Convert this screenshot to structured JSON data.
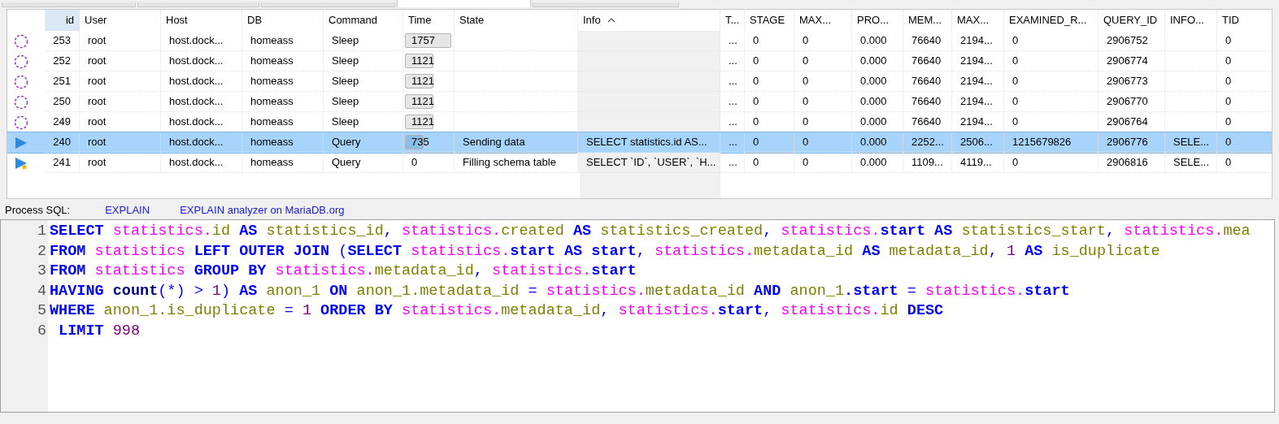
{
  "tabs": [
    {
      "selected": false
    },
    {
      "selected": false
    },
    {
      "selected": false
    },
    {
      "selected": true
    },
    {
      "selected": false
    }
  ],
  "columns": [
    {
      "sorted": false
    },
    {
      "label": "id",
      "sorted": false
    },
    {
      "label": "User",
      "sorted": false
    },
    {
      "label": "Host",
      "sorted": false
    },
    {
      "label": "DB",
      "sorted": false
    },
    {
      "label": "Command",
      "sorted": false
    },
    {
      "label": "Time",
      "sorted": false
    },
    {
      "label": "State",
      "sorted": false
    },
    {
      "label": "Info",
      "sorted": true
    },
    {
      "label": "T...",
      "sorted": false
    },
    {
      "label": "STAGE",
      "sorted": false
    },
    {
      "label": "MAX...",
      "sorted": false
    },
    {
      "label": "PRO...",
      "sorted": false
    },
    {
      "label": "MEM...",
      "sorted": false
    },
    {
      "label": "MAX...",
      "sorted": false
    },
    {
      "label": "EXAMINED_R...",
      "sorted": false
    },
    {
      "label": "QUERY_ID",
      "sorted": false
    },
    {
      "label": "INFO...",
      "sorted": false
    },
    {
      "label": "TID",
      "sorted": false
    }
  ],
  "rows": [
    {
      "kind": "sleep",
      "selected": false,
      "id": "253",
      "user": "root",
      "host": "host.dock...",
      "db": "homeass",
      "command": "Sleep",
      "time": "1757",
      "level": 1,
      "cells": [
        "...",
        "0",
        "0",
        "0.000",
        "76640",
        "2194...",
        "0",
        "2906752",
        null,
        "0"
      ]
    },
    {
      "kind": "sleep",
      "selected": false,
      "id": "252",
      "user": "root",
      "host": "host.dock...",
      "db": "homeass",
      "command": "Sleep",
      "time": "1121",
      "level": 0.62,
      "cells": [
        "...",
        "0",
        "0",
        "0.000",
        "76640",
        "2194...",
        "0",
        "2906774",
        null,
        "0"
      ]
    },
    {
      "kind": "sleep",
      "selected": false,
      "id": "251",
      "user": "root",
      "host": "host.dock...",
      "db": "homeass",
      "command": "Sleep",
      "time": "1121",
      "level": 0.62,
      "cells": [
        "...",
        "0",
        "0",
        "0.000",
        "76640",
        "2194...",
        "0",
        "2906773",
        null,
        "0"
      ]
    },
    {
      "kind": "sleep",
      "selected": false,
      "id": "250",
      "user": "root",
      "host": "host.dock...",
      "db": "homeass",
      "command": "Sleep",
      "time": "1121",
      "level": 0.62,
      "cells": [
        "...",
        "0",
        "0",
        "0.000",
        "76640",
        "2194...",
        "0",
        "2906770",
        null,
        "0"
      ]
    },
    {
      "kind": "sleep",
      "selected": false,
      "id": "249",
      "user": "root",
      "host": "host.dock...",
      "db": "homeass",
      "command": "Sleep",
      "time": "1121",
      "level": 0.62,
      "cells": [
        "...",
        "0",
        "0",
        "0.000",
        "76640",
        "2194...",
        "0",
        "2906764",
        null,
        "0"
      ]
    },
    {
      "kind": "query",
      "selected": true,
      "id": "240",
      "user": "root",
      "host": "host.dock...",
      "db": "homeass",
      "command": "Query",
      "time": "735",
      "level": 0.4,
      "state": "Sending data",
      "info": "SELECT statistics.id AS...",
      "cells": [
        "...",
        "0",
        "0",
        "0.000",
        "2252...",
        "2506...",
        "1215679826",
        "2906776",
        "SELE...",
        "0"
      ]
    },
    {
      "kind": "query_new",
      "selected": false,
      "id": "241",
      "user": "root",
      "host": "host.dock...",
      "db": "homeass",
      "command": "Query",
      "time": "0",
      "state": "Filling schema table",
      "info": "SELECT `ID`, `USER`, `H...",
      "cells": [
        "...",
        "0",
        "0",
        "0.000",
        "1109...",
        "4119...",
        "0",
        "2906816",
        "SELE...",
        "0"
      ]
    }
  ],
  "process_sql": {
    "label": "Process SQL:",
    "links": [
      "EXPLAIN",
      "EXPLAIN analyzer on MariaDB.org"
    ]
  },
  "editor": {
    "lines": [
      {
        "number": "1",
        "tokens": [
          {
            "kind": "kw",
            "text": "SELECT"
          },
          {
            "kind": "tbl",
            "text": " statistics."
          },
          {
            "kind": "col",
            "text": "id"
          },
          {
            "kind": "kw",
            "text": " AS"
          },
          {
            "kind": "col",
            "text": " statistics_id"
          },
          {
            "kind": "op",
            "text": ","
          },
          {
            "kind": "tbl",
            "text": " statistics."
          },
          {
            "kind": "col",
            "text": "created"
          },
          {
            "kind": "kw",
            "text": " AS"
          },
          {
            "kind": "col",
            "text": " statistics_created"
          },
          {
            "kind": "op",
            "text": ","
          },
          {
            "kind": "tbl",
            "text": " statistics."
          },
          {
            "kind": "kw",
            "text": "start"
          },
          {
            "kind": "kw",
            "text": " AS"
          },
          {
            "kind": "col",
            "text": " statistics_start"
          },
          {
            "kind": "op",
            "text": ","
          },
          {
            "kind": "tbl",
            "text": " statistics."
          },
          {
            "kind": "col",
            "text": "mea"
          }
        ]
      },
      {
        "number": "2",
        "tokens": [
          {
            "kind": "kw",
            "text": "FROM"
          },
          {
            "kind": "tbl",
            "text": " statistics"
          },
          {
            "kind": "kw",
            "text": " LEFT OUTER JOIN"
          },
          {
            "kind": "op",
            "text": " ("
          },
          {
            "kind": "kw",
            "text": "SELECT"
          },
          {
            "kind": "tbl",
            "text": " statistics."
          },
          {
            "kind": "kw",
            "text": "start"
          },
          {
            "kind": "kw",
            "text": " AS start"
          },
          {
            "kind": "op",
            "text": ","
          },
          {
            "kind": "tbl",
            "text": " statistics."
          },
          {
            "kind": "col",
            "text": "metadata_id"
          },
          {
            "kind": "kw",
            "text": " AS"
          },
          {
            "kind": "col",
            "text": " metadata_id"
          },
          {
            "kind": "op",
            "text": ","
          },
          {
            "kind": "num",
            "text": " 1"
          },
          {
            "kind": "kw",
            "text": " AS"
          },
          {
            "kind": "col",
            "text": " is_duplicate"
          }
        ]
      },
      {
        "number": "3",
        "tokens": [
          {
            "kind": "kw",
            "text": "FROM"
          },
          {
            "kind": "tbl",
            "text": " statistics"
          },
          {
            "kind": "kw",
            "text": " GROUP BY"
          },
          {
            "kind": "tbl",
            "text": " statistics."
          },
          {
            "kind": "col",
            "text": "metadata_id"
          },
          {
            "kind": "op",
            "text": ","
          },
          {
            "kind": "tbl",
            "text": " statistics."
          },
          {
            "kind": "kw",
            "text": "start"
          }
        ]
      },
      {
        "number": "4",
        "tokens": [
          {
            "kind": "kw",
            "text": "HAVING"
          },
          {
            "kind": "fn",
            "text": " count"
          },
          {
            "kind": "op",
            "text": "(*) >"
          },
          {
            "kind": "num",
            "text": " 1"
          },
          {
            "kind": "op",
            "text": ")"
          },
          {
            "kind": "kw",
            "text": " AS"
          },
          {
            "kind": "col",
            "text": " anon_1"
          },
          {
            "kind": "kw",
            "text": " ON"
          },
          {
            "kind": "col",
            "text": " anon_1.metadata_id"
          },
          {
            "kind": "op",
            "text": " ="
          },
          {
            "kind": "tbl",
            "text": " statistics."
          },
          {
            "kind": "col",
            "text": "metadata_id"
          },
          {
            "kind": "kw",
            "text": " AND"
          },
          {
            "kind": "col",
            "text": " anon_1"
          },
          {
            "kind": "kw",
            "text": ".start"
          },
          {
            "kind": "op",
            "text": " ="
          },
          {
            "kind": "tbl",
            "text": " statistics."
          },
          {
            "kind": "kw",
            "text": "start"
          }
        ]
      },
      {
        "number": "5",
        "tokens": [
          {
            "kind": "kw",
            "text": "WHERE"
          },
          {
            "kind": "col",
            "text": " anon_1.is_duplicate"
          },
          {
            "kind": "op",
            "text": " ="
          },
          {
            "kind": "num",
            "text": " 1"
          },
          {
            "kind": "kw",
            "text": " ORDER BY"
          },
          {
            "kind": "tbl",
            "text": " statistics."
          },
          {
            "kind": "col",
            "text": "metadata_id"
          },
          {
            "kind": "op",
            "text": ","
          },
          {
            "kind": "tbl",
            "text": " statistics."
          },
          {
            "kind": "kw",
            "text": "start"
          },
          {
            "kind": "op",
            "text": ","
          },
          {
            "kind": "tbl",
            "text": " statistics."
          },
          {
            "kind": "col",
            "text": "id"
          },
          {
            "kind": "kw",
            "text": " DESC"
          }
        ]
      },
      {
        "number": "6",
        "tokens": [
          {
            "kind": "kw",
            "text": " LIMIT"
          },
          {
            "kind": "num",
            "text": " 998"
          }
        ]
      }
    ]
  }
}
